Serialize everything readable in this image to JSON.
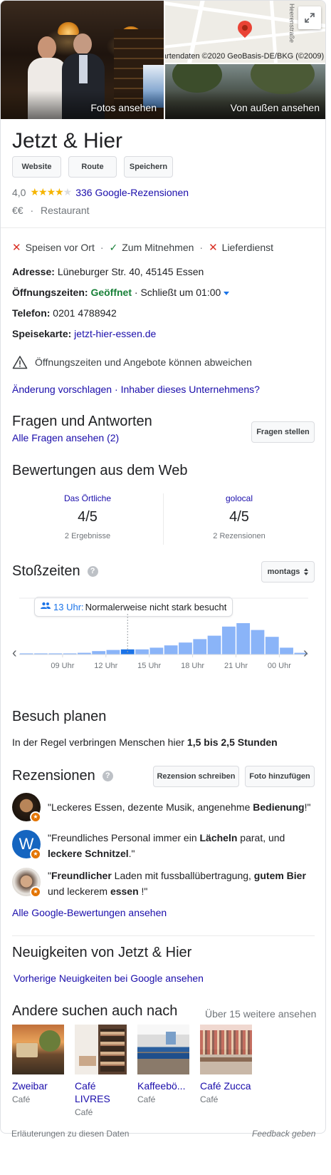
{
  "hero": {
    "photos_label": "Fotos ansehen",
    "outside_label": "Von außen ansehen",
    "map_credit": "artendaten ©2020 GeoBasis-DE/BKG (©2009)",
    "map_street": "Heerenstraße",
    "expand_icon": "expand-icon"
  },
  "business": {
    "name": "Jetzt & Hier",
    "buttons": {
      "website": "Website",
      "route": "Route",
      "save": "Speichern"
    },
    "rating": "4,0",
    "stars": 4,
    "reviews_link": "336 Google-Rezensionen",
    "price": "€€",
    "category": "Restaurant"
  },
  "services": [
    {
      "label": "Speisen vor Ort",
      "available": false
    },
    {
      "label": "Zum Mitnehmen",
      "available": true
    },
    {
      "label": "Lieferdienst",
      "available": false
    }
  ],
  "info": {
    "address_label": "Adresse:",
    "address": "Lüneburger Str. 40, 45145 Essen",
    "hours_label": "Öffnungszeiten:",
    "hours_status": "Geöffnet",
    "hours_detail": "· Schließt um 01:00",
    "phone_label": "Telefon:",
    "phone": "0201 4788942",
    "menu_label": "Speisekarte:",
    "menu_link": "jetzt-hier-essen.de",
    "warning": "Öffnungszeiten und Angebote können abweichen",
    "suggest_link": "Änderung vorschlagen",
    "owner_link": "Inhaber dieses Unternehmens?"
  },
  "qa": {
    "title": "Fragen und Antworten",
    "all_link": "Alle Fragen ansehen (2)",
    "ask_button": "Fragen stellen"
  },
  "web_reviews": {
    "title": "Bewertungen aus dem Web",
    "items": [
      {
        "source": "Das Örtliche",
        "score": "4/5",
        "count": "2 Ergebnisse"
      },
      {
        "source": "golocal",
        "score": "4/5",
        "count": "2 Rezensionen"
      }
    ]
  },
  "popular_times": {
    "title": "Stoßzeiten",
    "day": "montags",
    "live_hour": "13 Uhr:",
    "live_text": "Normalerweise nicht stark besucht",
    "chart_data": {
      "type": "bar",
      "categories": [
        "06",
        "07",
        "08",
        "09",
        "10",
        "11",
        "12",
        "13",
        "14",
        "15",
        "16",
        "17",
        "18",
        "19",
        "20",
        "21",
        "22",
        "23",
        "00",
        "01"
      ],
      "values": [
        2,
        2,
        2,
        2,
        3,
        6,
        8,
        9,
        9,
        12,
        16,
        21,
        27,
        33,
        49,
        55,
        43,
        31,
        12,
        3
      ],
      "highlight_index": 7,
      "current_index": 7,
      "tick_labels": [
        "09 Uhr",
        "12 Uhr",
        "15 Uhr",
        "18 Uhr",
        "21 Uhr",
        "00 Uhr"
      ],
      "tick_indices": [
        3,
        6,
        9,
        12,
        15,
        18
      ],
      "ylim": [
        0,
        100
      ],
      "colors": {
        "bar": "#8ab4f8",
        "highlight": "#1a73e8"
      }
    }
  },
  "visit": {
    "title": "Besuch planen",
    "prefix": "In der Regel verbringen Menschen hier ",
    "duration": "1,5 bis 2,5 Stunden"
  },
  "reviews": {
    "title": "Rezensionen",
    "write_button": "Rezension schreiben",
    "photo_button": "Foto hinzufügen",
    "items": [
      {
        "parts": [
          [
            "\"Leckeres Essen, dezente Musik, angenehme ",
            false
          ],
          [
            "Bedienung",
            true
          ],
          [
            "!\"",
            false
          ]
        ]
      },
      {
        "avatar_letter": "W",
        "parts": [
          [
            "\"Freundliches Personal immer ein ",
            false
          ],
          [
            "Lächeln",
            true
          ],
          [
            " parat, und ",
            false
          ],
          [
            "leckere Schnitzel",
            true
          ],
          [
            ".\"",
            false
          ]
        ]
      },
      {
        "parts": [
          [
            "\"",
            false
          ],
          [
            "Freundlicher",
            true
          ],
          [
            " Laden mit fussballübertragung, ",
            false
          ],
          [
            "gutem Bier",
            true
          ],
          [
            " und leckerem ",
            false
          ],
          [
            "essen",
            true
          ],
          [
            " !\"",
            false
          ]
        ]
      }
    ],
    "all_link": "Alle Google-Bewertungen ansehen"
  },
  "news": {
    "title": "Neuigkeiten von Jetzt & Hier",
    "link": "Vorherige Neuigkeiten bei Google ansehen"
  },
  "others": {
    "title": "Andere suchen auch nach",
    "more_link": "Über 15 weitere ansehen",
    "places": [
      {
        "name": "Zweibar",
        "type": "Café"
      },
      {
        "name": "Café LIVRES",
        "type": "Café"
      },
      {
        "name": "Kaffeebö...",
        "type": "Café"
      },
      {
        "name": "Café Zucca",
        "type": "Café"
      }
    ]
  },
  "footer": {
    "left": "Erläuterungen zu diesen Daten",
    "right": "Feedback geben"
  }
}
